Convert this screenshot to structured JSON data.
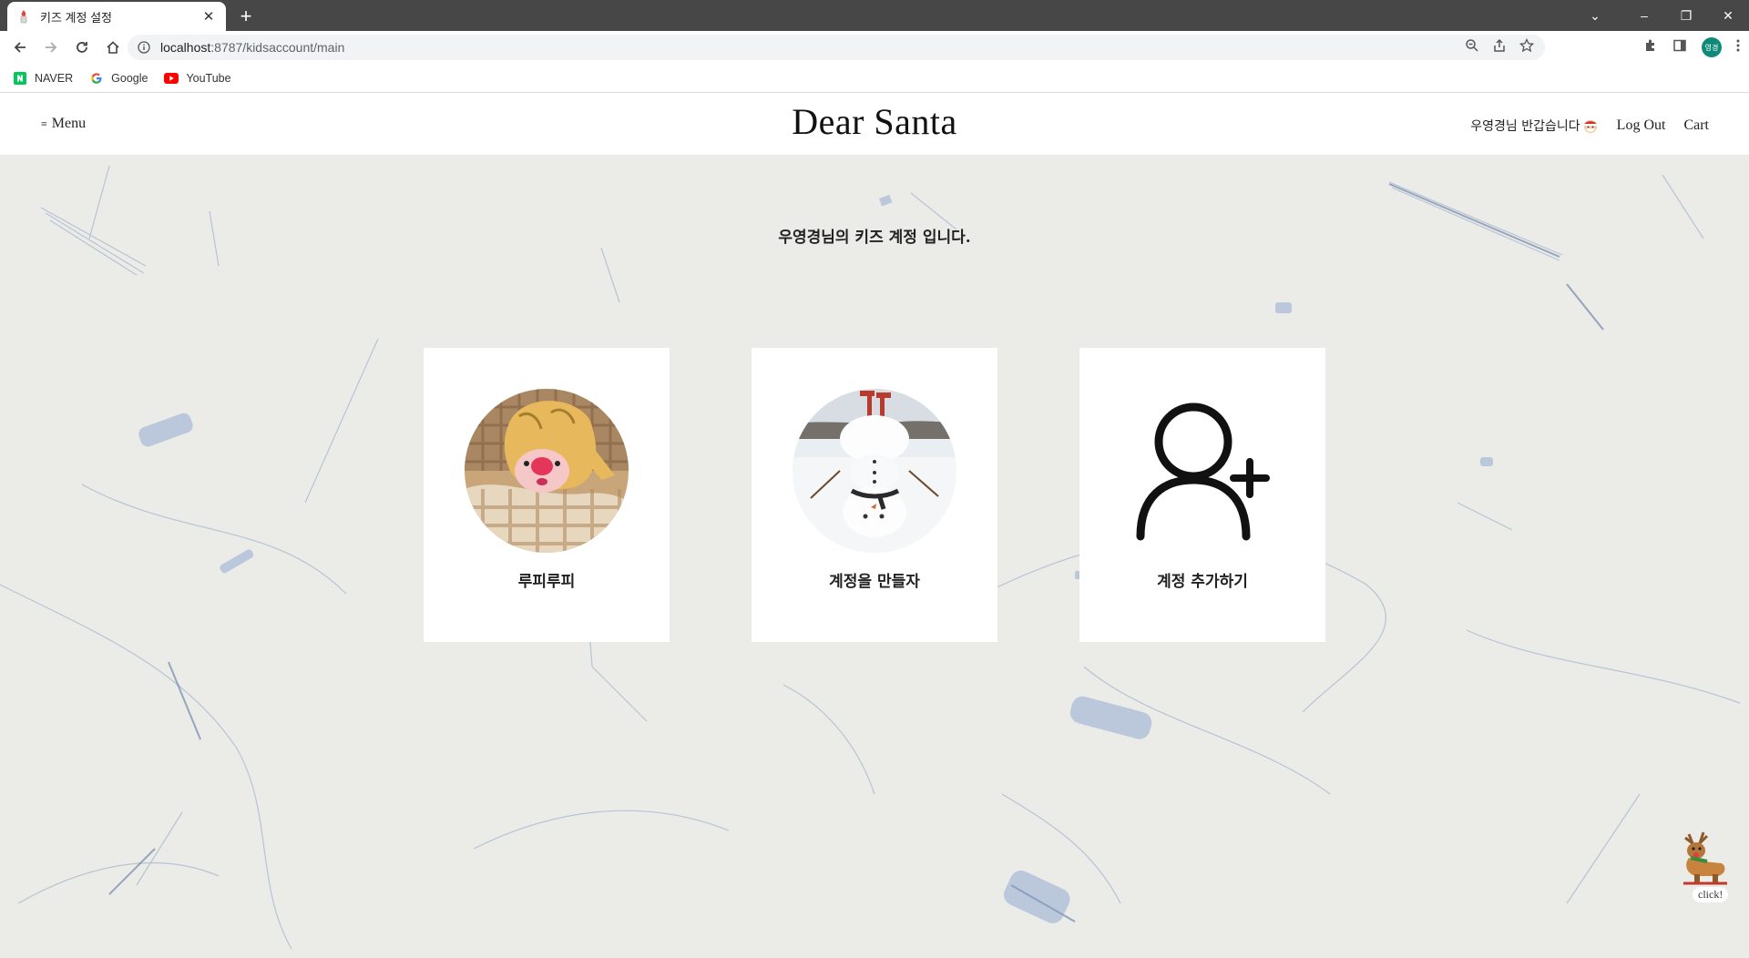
{
  "browser": {
    "tab": {
      "title": "키즈 계정 설정",
      "close_glyph": "✕"
    },
    "new_tab_glyph": "+",
    "window_controls": {
      "dropdown": "⌄",
      "minimize": "–",
      "restore": "❐",
      "close": "✕"
    },
    "url": {
      "host": "localhost",
      "rest": ":8787/kidsaccount/main"
    },
    "profile_initials": "영경",
    "bookmarks": [
      {
        "label": "NAVER",
        "icon": "naver-icon"
      },
      {
        "label": "Google",
        "icon": "google-icon"
      },
      {
        "label": "YouTube",
        "icon": "youtube-icon"
      }
    ]
  },
  "header": {
    "menu_glyph": "≡",
    "menu_label": "Menu",
    "title": "Dear Santa",
    "greeting": "우영경님 반갑습니다",
    "logout": "Log Out",
    "cart": "Cart"
  },
  "main": {
    "heading": "우영경님의 키즈 계정 입니다.",
    "cards": [
      {
        "label": "루피루피",
        "avatar": "loopy-plush-photo"
      },
      {
        "label": "계정을 만들자",
        "avatar": "upside-down-snowman-photo"
      },
      {
        "label": "계정 추가하기",
        "avatar": "add-user-icon"
      }
    ],
    "floating_button_label": "click!"
  },
  "colors": {
    "tabstrip": "#474747",
    "paper_background": "#ebebe7",
    "card": "#ffffff",
    "text": "#222222",
    "profile": "#0f8a79"
  }
}
